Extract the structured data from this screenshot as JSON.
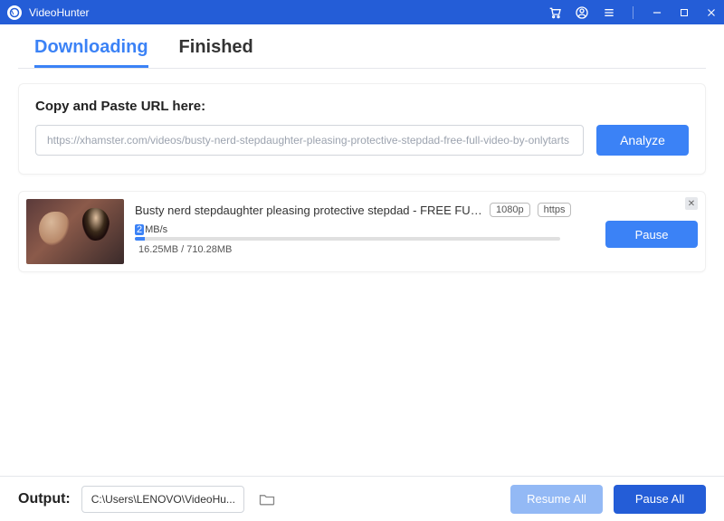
{
  "app": {
    "title": "VideoHunter"
  },
  "tabs": {
    "downloading": "Downloading",
    "finished": "Finished"
  },
  "urlCard": {
    "label": "Copy and Paste URL here:",
    "inputValue": "https://xhamster.com/videos/busty-nerd-stepdaughter-pleasing-protective-stepdad-free-full-video-by-onlytarts",
    "analyze": "Analyze"
  },
  "download": {
    "title": "Busty nerd stepdaughter pleasing protective stepdad - FREE FULL VIDEO by...",
    "badgeQuality": "1080p",
    "badgeProto": "https",
    "speedHead": "2",
    "speedTail": "MB/s",
    "progressPercent": 2.3,
    "sizeText": "16.25MB / 710.28MB",
    "pause": "Pause"
  },
  "bottom": {
    "outputLabel": "Output:",
    "outputPath": "C:\\Users\\LENOVO\\VideoHu...",
    "resumeAll": "Resume All",
    "pauseAll": "Pause All"
  }
}
